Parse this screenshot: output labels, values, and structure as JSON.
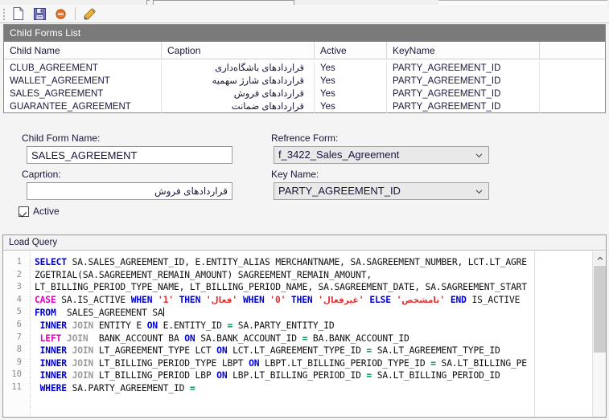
{
  "toolbar": {
    "buttons": [
      {
        "name": "new-document-icon",
        "label": "New"
      },
      {
        "name": "save-icon",
        "label": "Save"
      },
      {
        "name": "delete-icon",
        "label": "Delete"
      },
      {
        "name": "edit-icon",
        "label": "Edit"
      }
    ]
  },
  "grid": {
    "caption": "Child Forms List",
    "columns": [
      "Child Name",
      "Caption",
      "Active",
      "KeyName",
      ""
    ],
    "rows": [
      {
        "child_name": "CLUB_AGREEMENT",
        "caption": "قراردادهای باشگاه‌داری",
        "active": "Yes",
        "key_name": "PARTY_AGREEMENT_ID",
        "extra": ""
      },
      {
        "child_name": "WALLET_AGREEMENT",
        "caption": "قراردادهای شارژ سهمیه",
        "active": "Yes",
        "key_name": "PARTY_AGREEMENT_ID",
        "extra": ""
      },
      {
        "child_name": "SALES_AGREEMENT",
        "caption": "قراردادهای فروش",
        "active": "Yes",
        "key_name": "PARTY_AGREEMENT_ID",
        "extra": ""
      },
      {
        "child_name": "GUARANTEE_AGREEMENT",
        "caption": "قراردادهای ضمانت",
        "active": "Yes",
        "key_name": "PARTY_AGREEMENT_ID",
        "extra": ""
      }
    ]
  },
  "form": {
    "child_form_name_label": "Child Form Name:",
    "child_form_name_value": "SALES_AGREEMENT",
    "caption_label": "Caprtion:",
    "caption_value": "قراردادهای فروش",
    "reference_form_label": "Refrence Form:",
    "reference_form_value": "f_3422_Sales_Agreement",
    "key_name_label": "Key Name:",
    "key_name_value": "PARTY_AGREEMENT_ID",
    "active_label": "Active",
    "active_checked": "true"
  },
  "query": {
    "caption": "Load Query",
    "line_numbers": [
      "1",
      "2",
      "3",
      "4",
      "5",
      "6",
      "7",
      "8",
      "9",
      "10",
      "11"
    ],
    "lines": [
      "SELECT SA.SALES_AGREEMENT_ID, E.ENTITY_ALIAS MERCHANTNAME, SA.SAGREEMENT_NUMBER, LCT.LT_AGRE",
      "ZGETRIAL(SA.SAGREEMENT_REMAIN_AMOUNT) SAGREEMENT_REMAIN_AMOUNT,",
      "LT_BILLING_PERIOD_TYPE_NAME, LT_BILLING_PERIOD_NAME, SA.SAGREEMENT_DATE, SA.SAGREEMENT_START",
      "CASE SA.IS_ACTIVE WHEN '1' THEN 'فعال' WHEN '0' THEN 'غیرفعال' ELSE 'نامشخص' END IS_ACTIVE",
      "FROM  SALES_AGREEMENT SA",
      " INNER JOIN ENTITY E ON E.ENTITY_ID = SA.PARTY_ENTITY_ID",
      " LEFT JOIN  BANK_ACCOUNT BA ON SA.BANK_ACCOUNT_ID = BA.BANK_ACCOUNT_ID",
      " INNER JOIN LT_AGREEMENT_TYPE LCT ON LCT.LT_AGREEMENT_TYPE_ID = SA.LT_AGREEMENT_TYPE_ID",
      " INNER JOIN LT_BILLING_PERIOD_TYPE LBPT ON LBPT.LT_BILLING_PERIOD_TYPE_ID = SA.LT_BILLING_PE",
      " INNER JOIN LT_BILLING_PERIOD LBP ON LBP.LT_BILLING_PERIOD_ID = SA.LT_BILLING_PERIOD_ID",
      " WHERE SA.PARTY_AGREEMENT_ID ="
    ],
    "persian_strings": [
      "فعال",
      "غیرفعال",
      "نامشخص"
    ]
  },
  "colors": {
    "caption_bar": "#7a7a7a",
    "keyword": "#0000d8",
    "keyword_alt": "#e000c0",
    "string": "#e03030",
    "operator": "#009050",
    "join": "#9a9a9a"
  }
}
